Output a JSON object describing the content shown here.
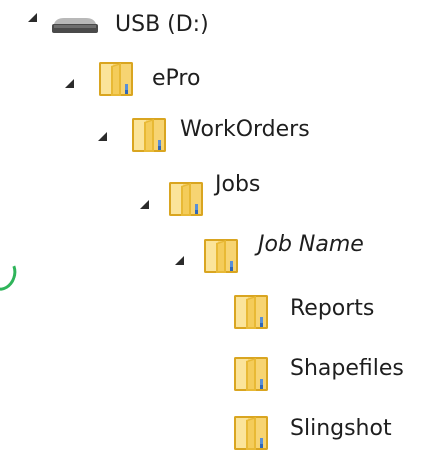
{
  "tree": {
    "drive": {
      "label": "USB (D:)",
      "icon": "usb-drive-icon",
      "expanded": true
    },
    "epro": {
      "label": "ePro",
      "icon": "folder-icon",
      "expanded": true
    },
    "workorders": {
      "label": "WorkOrders",
      "icon": "folder-icon",
      "expanded": true
    },
    "jobs": {
      "label": "Jobs",
      "icon": "folder-icon",
      "expanded": true
    },
    "job_name": {
      "label": "Job Name",
      "icon": "folder-icon",
      "expanded": true
    },
    "reports": {
      "label": "Reports",
      "icon": "folder-icon"
    },
    "shapefiles": {
      "label": "Shapefiles",
      "icon": "folder-icon"
    },
    "slingshot": {
      "label": "Slingshot",
      "icon": "folder-icon"
    }
  },
  "colors": {
    "folder_body": "#f4cc5a",
    "folder_dark": "#d9a520",
    "folder_light": "#fbe49a",
    "expander": "#2b2b2b",
    "text": "#1e1e1e"
  }
}
